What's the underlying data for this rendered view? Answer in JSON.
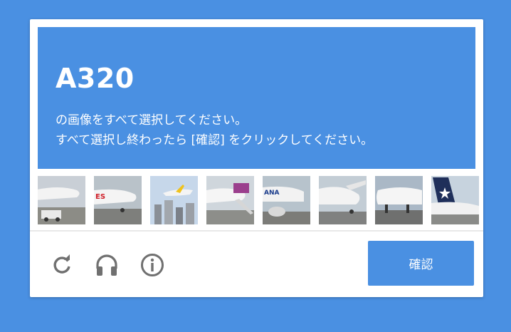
{
  "challenge": {
    "title": "A320",
    "instruction_line1": "の画像をすべて選択してください。",
    "instruction_line2": "すべて選択し終わったら [確認] をクリックしてください。"
  },
  "tiles": [
    {
      "icon": "aircraft-photo"
    },
    {
      "icon": "aircraft-photo"
    },
    {
      "icon": "aircraft-photo"
    },
    {
      "icon": "aircraft-photo"
    },
    {
      "icon": "aircraft-photo"
    },
    {
      "icon": "aircraft-photo"
    },
    {
      "icon": "aircraft-photo"
    },
    {
      "icon": "aircraft-photo"
    }
  ],
  "footer": {
    "reload_icon": "reload-icon",
    "audio_icon": "headphones-icon",
    "info_icon": "info-icon",
    "verify_label": "確認"
  },
  "colors": {
    "accent": "#4a90e2",
    "background": "#4a90e2",
    "card": "#ffffff",
    "icon": "#707070"
  }
}
